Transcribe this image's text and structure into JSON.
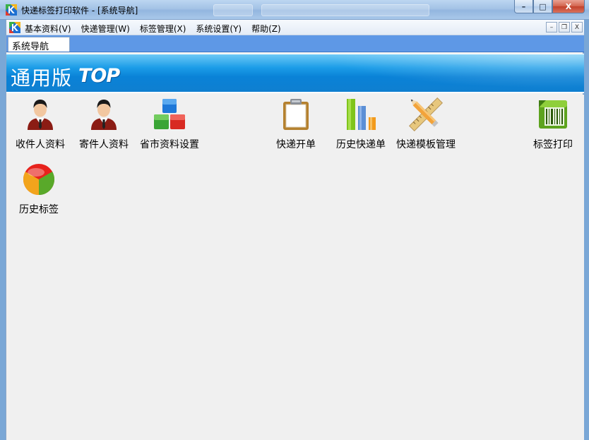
{
  "window": {
    "title": "快递标签打印软件 - [系统导航]",
    "buttons": {
      "minimize": "–",
      "maximize": "□",
      "close": "X"
    }
  },
  "menu": {
    "items": [
      "基本资料(V)",
      "快递管理(W)",
      "标签管理(X)",
      "系统设置(Y)",
      "帮助(Z)"
    ],
    "mdi_buttons": {
      "minimize": "–",
      "restore": "❐",
      "close": "X"
    }
  },
  "tabs": [
    {
      "label": "系统导航"
    }
  ],
  "banner": {
    "title": "通用版",
    "tag": "TOP"
  },
  "nav": {
    "receiver": "收件人资料",
    "sender": "寄件人资料",
    "province": "省市资料设置",
    "new_order": "快递开单",
    "history_orders": "历史快递单",
    "template": "快递模板管理",
    "label_print": "标签打印",
    "history_labels": "历史标签"
  },
  "colors": {
    "accent": "#5e98e6",
    "banner": "#0a82d7"
  }
}
